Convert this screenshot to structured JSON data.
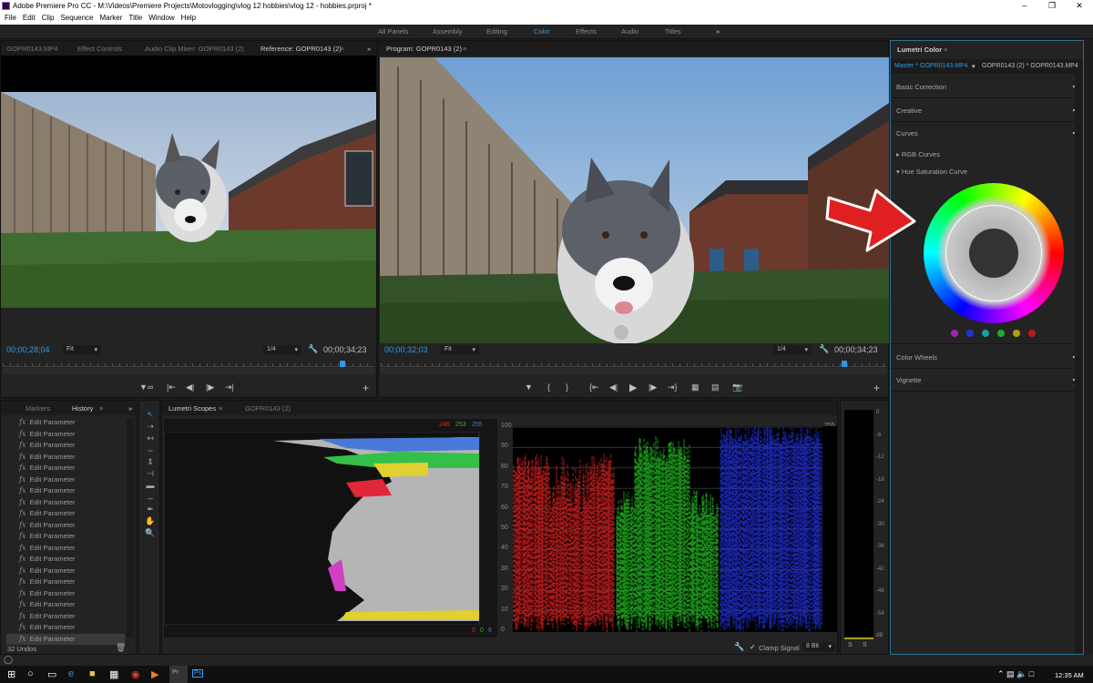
{
  "window": {
    "title": "Adobe Premiere Pro CC - M:\\Videos\\Premiere Projects\\Motovlogging\\vlog 12 hobbies\\vlog 12 - hobbies.prproj *"
  },
  "menu": [
    "File",
    "Edit",
    "Clip",
    "Sequence",
    "Marker",
    "Title",
    "Window",
    "Help"
  ],
  "workspaces": {
    "items": [
      "All Panels",
      "Assembly",
      "Editing",
      "Color",
      "Effects",
      "Audio",
      "Titles"
    ],
    "active": "Color",
    "more": "»"
  },
  "source_panel": {
    "tabs": [
      ": GOPR0143.MP4",
      "Effect Controls",
      "Audio Clip Mixer: GOPR0143 (2)",
      "Reference: GOPR0143 (2)"
    ],
    "active_tab": "Reference: GOPR0143 (2)",
    "timecode": "00;00;28;04",
    "zoom": "Fit",
    "resolution": "1/4",
    "duration": "00;00;34;23",
    "playhead_fraction": 0.91
  },
  "program_panel": {
    "tab": "Program: GOPR0143 (2)",
    "timecode": "00;00;32;03",
    "zoom": "Fit",
    "resolution": "1/4",
    "duration": "00;00;34;23",
    "playhead_fraction": 0.91
  },
  "history_panel": {
    "tabs": [
      "Markers",
      "History"
    ],
    "active_tab": "History",
    "items": [
      "Edit Parameter",
      "Edit Parameter",
      "Edit Parameter",
      "Edit Parameter",
      "Edit Parameter",
      "Edit Parameter",
      "Edit Parameter",
      "Edit Parameter",
      "Edit Parameter",
      "Edit Parameter",
      "Edit Parameter",
      "Edit Parameter",
      "Edit Parameter",
      "Edit Parameter",
      "Edit Parameter",
      "Edit Parameter",
      "Edit Parameter",
      "Edit Parameter",
      "Edit Parameter",
      "Edit Parameter"
    ],
    "undos": "32 Undos"
  },
  "scopes_panel": {
    "tabs": [
      "Lumetri Scopes",
      "GOPR0143 (2)"
    ],
    "active_tab": "Lumetri Scopes",
    "hist_top": {
      "r": "246",
      "g": "253",
      "b": "255"
    },
    "hist_bottom": {
      "r": "0",
      "g": "0",
      "b": "6"
    },
    "ire_labels": [
      "100",
      "90",
      "80",
      "70",
      "60",
      "50",
      "40",
      "30",
      "20",
      "10",
      "0"
    ],
    "code_labels": [
      "255",
      "230",
      "204",
      "179",
      "153",
      "128",
      "102",
      "77",
      "51",
      "26",
      "0"
    ],
    "clamp_signal": "Clamp Signal",
    "clamp_checked": true,
    "bit_depth": "8 Bit"
  },
  "audio_meter": {
    "labels": [
      "0",
      "-6",
      "-12",
      "-18",
      "-24",
      "-30",
      "-36",
      "-42",
      "-48",
      "-54",
      "dB"
    ],
    "solo": [
      "S",
      "S"
    ]
  },
  "lumetri": {
    "title": "Lumetri Color",
    "master": "Master * GOPR0143.MP4",
    "clip": "GOPR0143 (2) * GOPR0143.MP4",
    "sections": [
      {
        "label": "Basic Correction",
        "checked": true
      },
      {
        "label": "Creative",
        "checked": true
      },
      {
        "label": "Curves",
        "checked": true
      }
    ],
    "rgb_curves": "RGB Curves",
    "hue_sat_curve": "Hue Saturation Curve",
    "swatch_colors": [
      "#9b27b0",
      "#2233dd",
      "#1aa0a0",
      "#22aa33",
      "#b0a010",
      "#c01818"
    ],
    "sections_after": [
      {
        "label": "Color Wheels",
        "checked": true
      },
      {
        "label": "Vignette",
        "checked": true
      }
    ],
    "annotation": "red-arrow-pointing-at-hue-wheel"
  },
  "taskbar": {
    "time": "12:35 AM"
  },
  "colors": {
    "accent": "#2d9ae0",
    "panel": "#232323",
    "arrow": "#e02020"
  }
}
